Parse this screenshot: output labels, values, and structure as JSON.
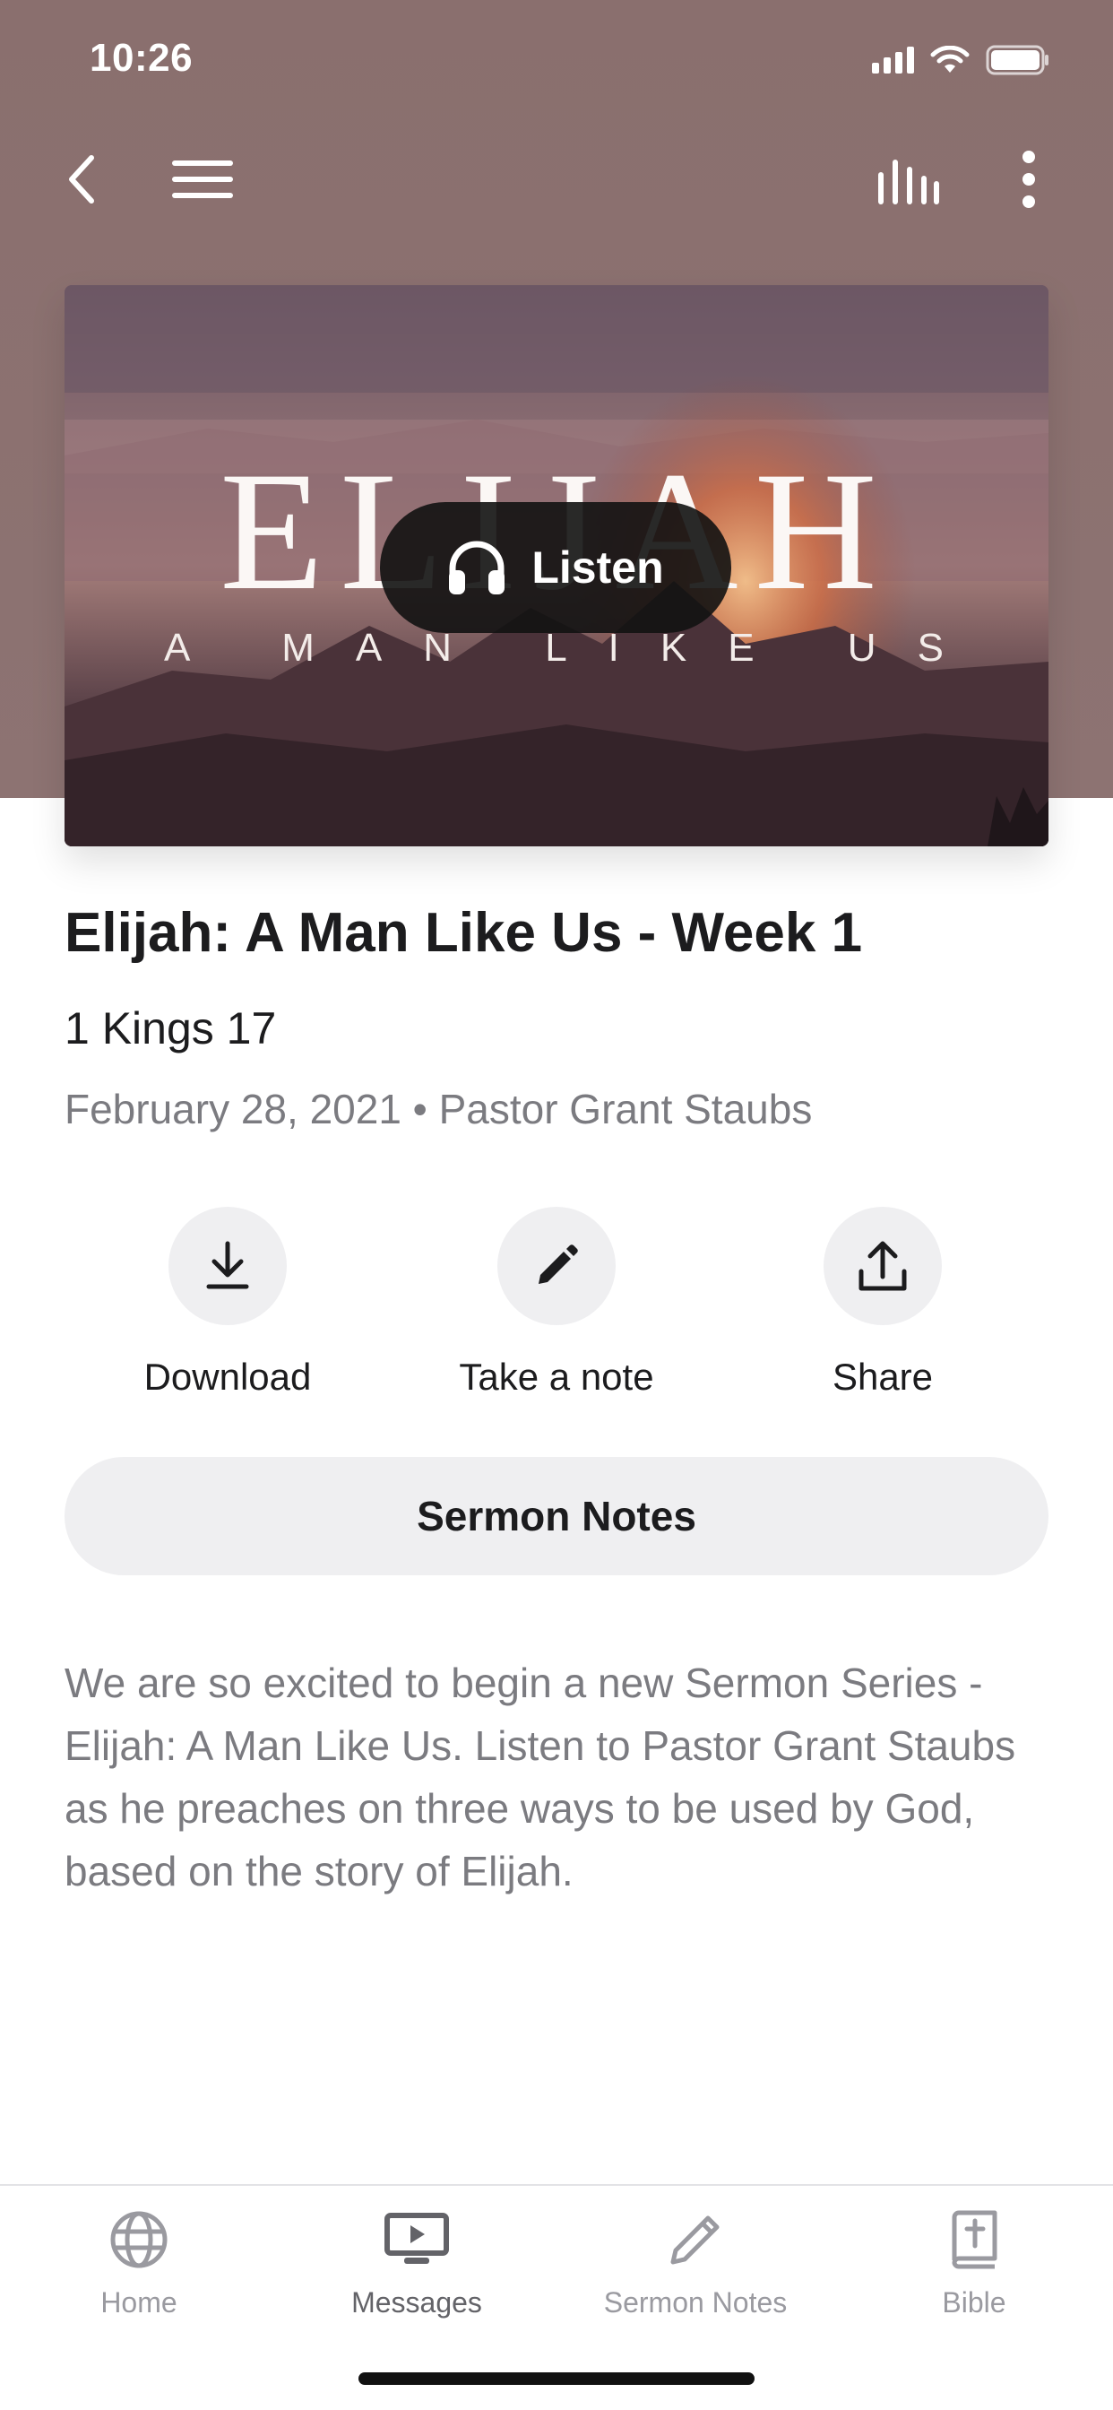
{
  "status_bar": {
    "time": "10:26"
  },
  "nav": {
    "back_icon": "chevron-left-icon",
    "menu_icon": "hamburger-icon",
    "audio_icon": "audio-bars-icon",
    "more_icon": "vertical-ellipsis-icon"
  },
  "hero": {
    "title": "ELIJAH",
    "subtitle": "A MAN LIKE US",
    "listen_label": "Listen",
    "listen_icon": "headphones-icon"
  },
  "sermon": {
    "title": "Elijah: A Man Like Us - Week 1",
    "scripture": "1 Kings 17",
    "meta": "February 28, 2021 • Pastor Grant Staubs",
    "description": "We are so excited to begin a new Sermon Series - Elijah: A Man Like Us. Listen to Pastor Grant Staubs as he preaches on three ways to be used by God, based on the story of Elijah."
  },
  "actions": [
    {
      "label": "Download",
      "icon": "download-icon"
    },
    {
      "label": "Take a note",
      "icon": "pencil-icon"
    },
    {
      "label": "Share",
      "icon": "share-icon"
    }
  ],
  "notes_button": {
    "label": "Sermon Notes"
  },
  "tabs": [
    {
      "label": "Home",
      "icon": "globe-icon",
      "active": false
    },
    {
      "label": "Messages",
      "icon": "tv-play-icon",
      "active": true
    },
    {
      "label": "Sermon Notes",
      "icon": "pencil-icon",
      "active": false
    },
    {
      "label": "Bible",
      "icon": "bible-icon",
      "active": false
    }
  ],
  "colors": {
    "header_background": "#8a6f6e",
    "button_background": "#efeff1",
    "secondary_text": "#7b7b80"
  }
}
